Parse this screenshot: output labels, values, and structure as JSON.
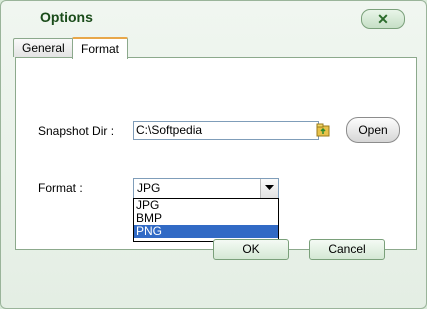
{
  "window": {
    "title": "Options",
    "close_label": "✕"
  },
  "tabs": [
    {
      "label": "General",
      "active": false
    },
    {
      "label": "Format",
      "active": true
    }
  ],
  "snapshot": {
    "label": "Snapshot Dir :",
    "value": "C:\\Softpedia",
    "open_label": "Open"
  },
  "format": {
    "label": "Format :",
    "selected": "JPG",
    "options": [
      "JPG",
      "BMP",
      "PNG"
    ],
    "highlighted": "PNG"
  },
  "buttons": {
    "ok": "OK",
    "cancel": "Cancel"
  },
  "colors": {
    "title": "#1a4c1a",
    "highlight": "#316ac5",
    "tab_accent": "#e8a74a"
  }
}
